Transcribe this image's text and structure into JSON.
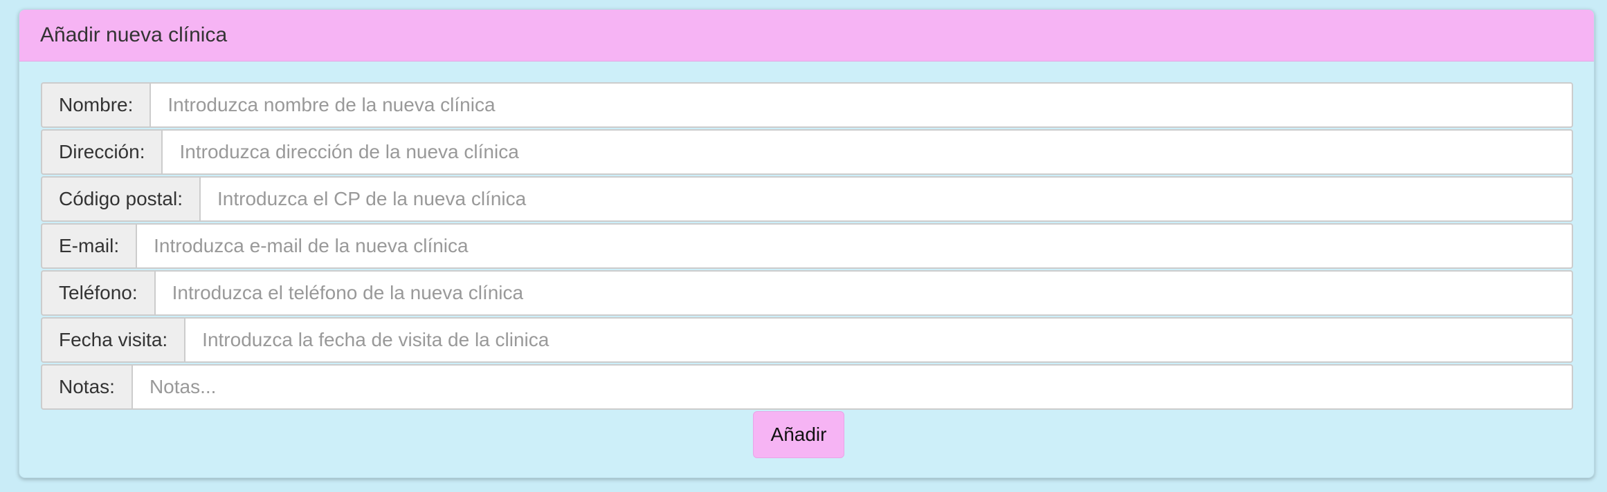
{
  "panel": {
    "title": "Añadir nueva clínica"
  },
  "form": {
    "fields": [
      {
        "label": "Nombre:",
        "placeholder": "Introduzca nombre de la nueva clínica",
        "value": ""
      },
      {
        "label": "Dirección:",
        "placeholder": "Introduzca dirección de la nueva clínica",
        "value": ""
      },
      {
        "label": "Código postal:",
        "placeholder": "Introduzca el CP de la nueva clínica",
        "value": ""
      },
      {
        "label": "E-mail:",
        "placeholder": "Introduzca e-mail de la nueva clínica",
        "value": ""
      },
      {
        "label": "Teléfono:",
        "placeholder": "Introduzca el teléfono de la nueva clínica",
        "value": ""
      },
      {
        "label": "Fecha visita:",
        "placeholder": "Introduzca la fecha de visita de la clinica",
        "value": ""
      },
      {
        "label": "Notas:",
        "placeholder": "Notas...",
        "value": ""
      }
    ],
    "submit_label": "Añadir"
  },
  "colors": {
    "background": "#c9ecf7",
    "panel_body": "#cdeff9",
    "accent": "#f6b4f4"
  }
}
